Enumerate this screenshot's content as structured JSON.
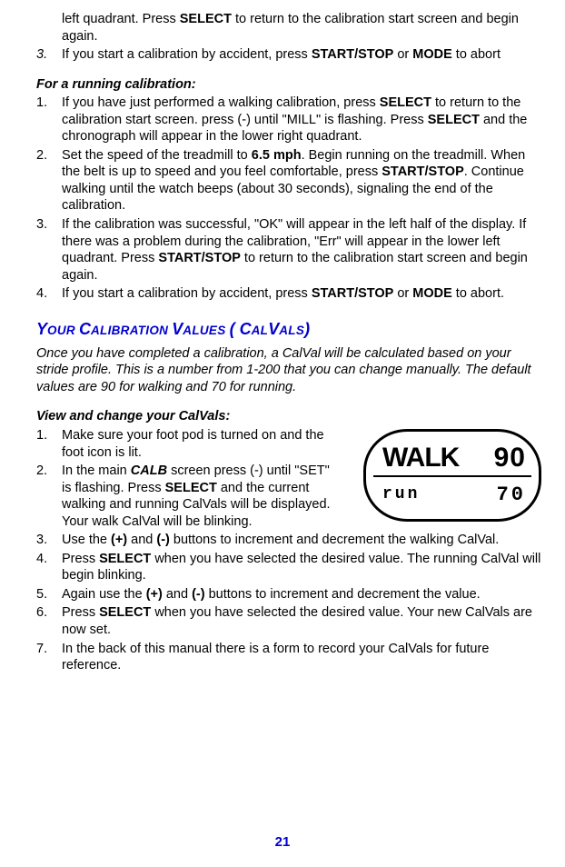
{
  "frag1": "left quadrant.  Press ",
  "frag1b": "SELECT",
  "frag1c": " to return to the calibration start screen and begin again.",
  "li3a": "If you start a calibration by accident, press ",
  "li3b": "START/STOP",
  "li3c": " or ",
  "li3d": "MODE",
  "li3e": " to abort",
  "running_hd": "For a running calibration:",
  "r1a": "If you have just performed a walking calibration, press ",
  "r1b": "SELECT",
  "r1c": " to return to the calibration start screen. press (-) until \"MILL\" is flashing.  Press ",
  "r1d": "SELECT",
  "r1e": " and the chronograph will appear in the lower right quadrant.",
  "r2a": "Set the speed of the treadmill to ",
  "r2b": "6.5 mph",
  "r2c": ".  Begin running on the treadmill.  When the belt is up to speed and you feel comfortable, press ",
  "r2d": "START/STOP",
  "r2e": ".  Continue walking until the watch beeps (about 30 seconds), signaling the end of the calibration.",
  "r3a": "If the calibration was successful, \"OK\" will appear in the left half of the display.  If there was a problem during the calibration, \"Err\" will appear in the lower left quadrant. Press ",
  "r3b": "START/STOP",
  "r3c": " to return to the calibration start screen and begin again.",
  "r4a": "If you start a calibration by accident, press ",
  "r4b": "START/STOP",
  "r4c": " or ",
  "r4d": "MODE",
  "r4e": " to abort.",
  "sec_y": "Y",
  "sec_our": "OUR ",
  "sec_c": "C",
  "sec_alibration": "ALIBRATION ",
  "sec_v": "V",
  "sec_alues": "ALUES ",
  "sec_paren1": "( ",
  "sec_c2": "C",
  "sec_al": "AL",
  "sec_v2": "V",
  "sec_als": "ALS",
  "sec_paren2": ")",
  "intro": "Once you have completed a calibration, a CalVal will be calculated based on your stride profile.  This is a number from 1-200 that you can change manually.   The default values are 90 for walking and 70 for running.",
  "view_hd": "View and change your CalVals:",
  "c1": "Make sure your foot pod is turned on and the foot icon is lit.",
  "c2a": "In the main ",
  "c2b": "CALB",
  "c2c": " screen press (-) until \"SET\" is flashing.  Press ",
  "c2d": "SELECT",
  "c2e": " and the current walking and running CalVals will be displayed. Your walk CalVal will be blinking.",
  "c3a": "Use the ",
  "c3b": "(+)",
  "c3c": " and ",
  "c3d": "(-)",
  "c3e": " buttons to increment and decrement the walking CalVal.",
  "c4a": "Press ",
  "c4b": "SELECT",
  "c4c": " when you have selected the desired value.  The running CalVal will begin blinking.",
  "c5a": "Again use the ",
  "c5b": "(+)",
  "c5c": " and ",
  "c5d": "(-)",
  "c5e": " buttons to increment and decrement the value.",
  "c6a": "Press ",
  "c6b": "SELECT",
  "c6c": " when you have selected the desired value.  Your new CalVals are now set.",
  "c7": "In the back of this manual there is a form to record your CalVals for future reference.",
  "lcd_walk": "WALK",
  "lcd_90": "90",
  "lcd_run": "run",
  "lcd_70": "70",
  "pagenum": "21"
}
